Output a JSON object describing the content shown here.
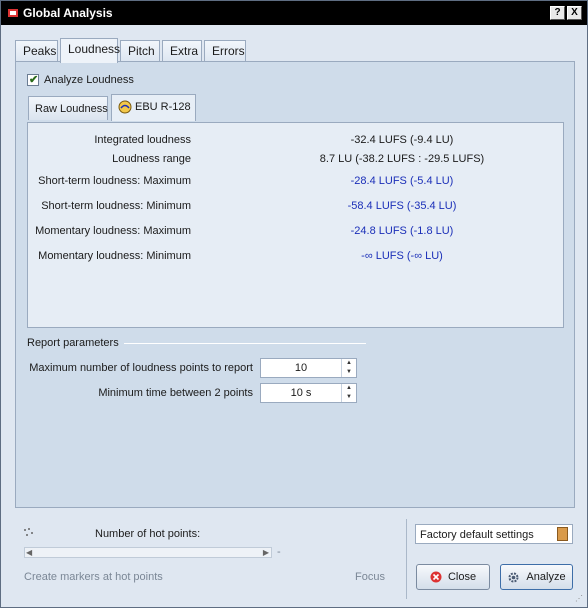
{
  "window": {
    "title": "Global Analysis",
    "help_glyph": "?",
    "close_glyph": "X"
  },
  "tabs": [
    {
      "label": "Peaks"
    },
    {
      "label": "Loudness"
    },
    {
      "label": "Pitch"
    },
    {
      "label": "Extra"
    },
    {
      "label": "Errors"
    }
  ],
  "active_tab": "Loudness",
  "analyze_loudness": {
    "label": "Analyze Loudness",
    "checked": true
  },
  "subtabs": [
    {
      "label": "Raw Loudness"
    },
    {
      "label": "EBU R-128"
    }
  ],
  "active_subtab": "EBU R-128",
  "ebu": {
    "rows": [
      {
        "label": "Integrated loudness",
        "value": "-32.4 LUFS (-9.4 LU)"
      },
      {
        "label": "Loudness range",
        "value": "8.7 LU (-38.2 LUFS : -29.5 LUFS)"
      },
      {
        "label": "Short-term loudness: Maximum",
        "value": "-28.4 LUFS (-5.4 LU)"
      },
      {
        "label": "Short-term loudness: Minimum",
        "value": "-58.4 LUFS (-35.4 LU)"
      },
      {
        "label": "Momentary loudness: Maximum",
        "value": "-24.8 LUFS (-1.8 LU)"
      },
      {
        "label": "Momentary loudness: Minimum",
        "value": "-∞ LUFS (-∞ LU)"
      }
    ],
    "value_color_link": "#1b2fb8"
  },
  "report": {
    "title": "Report parameters",
    "max_points_label": "Maximum number of loudness points to report",
    "max_points_value": "10",
    "min_time_label": "Minimum time between 2 points",
    "min_time_value": "10 s"
  },
  "bottom": {
    "hot_points_label": "Number of hot points:",
    "slider_value_text": "-",
    "create_markers_label": "Create markers at hot points",
    "focus_label": "Focus",
    "preset_value": "Factory default settings",
    "close_label": "Close",
    "analyze_label": "Analyze"
  }
}
